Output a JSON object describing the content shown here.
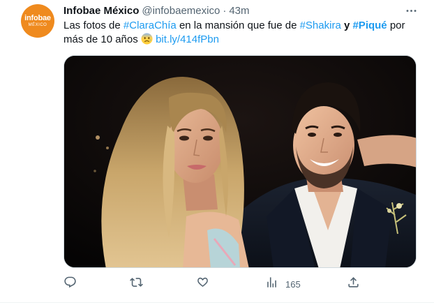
{
  "author": {
    "avatar_brand": "infobae",
    "avatar_sub": "MÉXICO",
    "name": "Infobae México",
    "handle": "@infobaemexico",
    "separator": "·",
    "time": "43m"
  },
  "tweet": {
    "text_1": "Las fotos de ",
    "hashtag_1": "#ClaraChía",
    "text_2": " en la mansión que fue de ",
    "hashtag_2": "#Shakira",
    "text_3": " y ",
    "hashtag_3": "#Piqué",
    "text_4": " por más de 10 años ",
    "link": "bit.ly/414fPbn"
  },
  "actions": {
    "views_count": "165"
  },
  "icons": {
    "more": "more-icon",
    "reply": "reply-icon",
    "retweet": "retweet-icon",
    "like": "like-icon",
    "views": "views-icon",
    "share": "share-icon",
    "emoji": "anxious-face-emoji"
  },
  "colors": {
    "link": "#1d9bf0",
    "muted": "#536471",
    "brand": "#ef8a1e"
  }
}
